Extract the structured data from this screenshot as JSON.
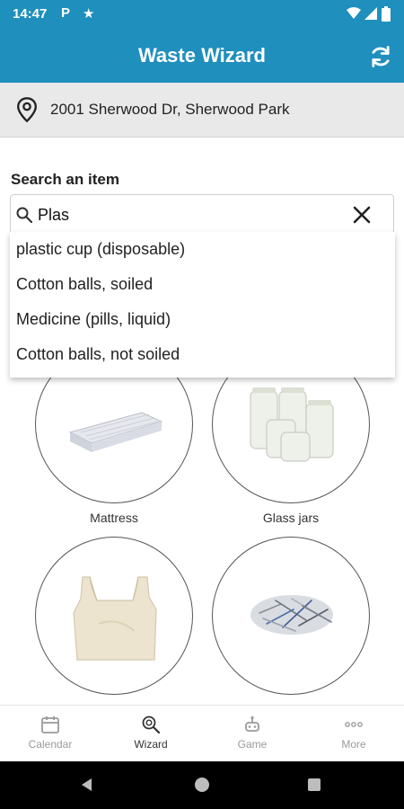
{
  "status_bar": {
    "time": "14:47",
    "icons": [
      "parking-icon",
      "star-icon",
      "wifi-icon",
      "signal-icon",
      "battery-icon"
    ]
  },
  "app_bar": {
    "title": "Waste Wizard",
    "icon": "refresh-icon"
  },
  "address": {
    "icon": "location-pin-icon",
    "text": "2001 Sherwood Dr, Sherwood Park"
  },
  "search": {
    "label": "Search an item",
    "value": "Plas",
    "icons": [
      "search-icon",
      "clear-icon"
    ]
  },
  "suggestions": [
    "plastic cup (disposable)",
    "Cotton balls, soiled",
    "Medicine (pills, liquid)",
    "Cotton balls, not soiled"
  ],
  "items": [
    {
      "label": "Mattress"
    },
    {
      "label": "Glass jars"
    },
    {
      "label": ""
    },
    {
      "label": ""
    }
  ],
  "bottom_nav": [
    {
      "label": "Calendar",
      "icon": "calendar-icon",
      "active": false
    },
    {
      "label": "Wizard",
      "icon": "wizard-search-icon",
      "active": true
    },
    {
      "label": "Game",
      "icon": "game-icon",
      "active": false
    },
    {
      "label": "More",
      "icon": "more-dots-icon",
      "active": false
    }
  ],
  "colors": {
    "primary": "#1f8fbd",
    "address_bg": "#e9e9e9",
    "nav_inactive": "#9a9a9a",
    "nav_active": "#333333"
  }
}
